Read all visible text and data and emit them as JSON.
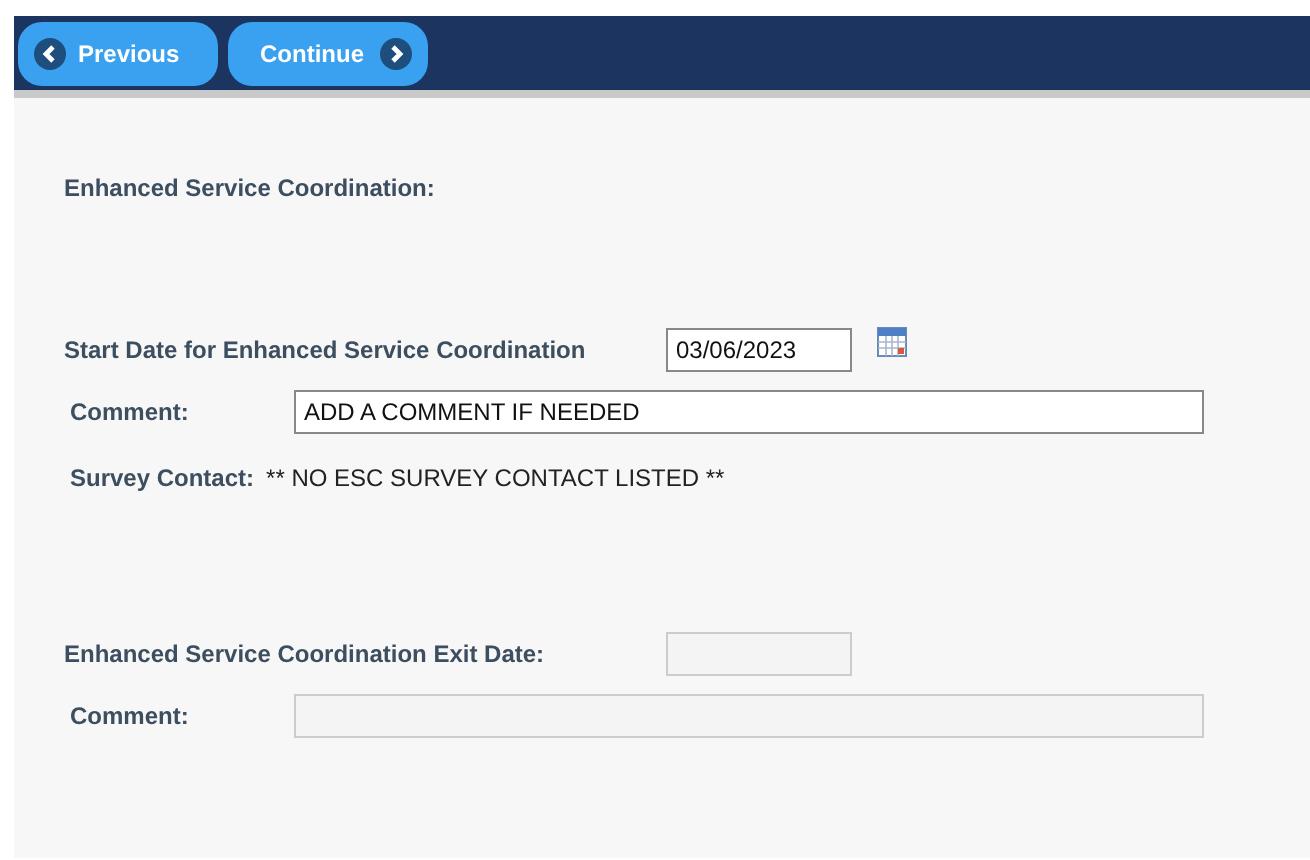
{
  "nav_buttons": [
    {
      "label": "Previous",
      "kind": "previous"
    },
    {
      "label": "Continue",
      "kind": "next"
    }
  ],
  "section_title": "Enhanced Service Coordination:",
  "start_date": {
    "label": "Start Date for Enhanced Service Coordination",
    "value": "03/06/2023",
    "disabled": false
  },
  "start_comment": {
    "label": "Comment:",
    "value": "ADD A COMMENT IF NEEDED",
    "disabled": false
  },
  "survey_contact": {
    "label": "Survey Contact:",
    "value": "** NO ESC SURVEY CONTACT LISTED **"
  },
  "exit_date": {
    "label": "Enhanced Service Coordination Exit Date:",
    "disabled": true
  },
  "exit_comment": {
    "label": "Comment:",
    "disabled": true
  }
}
